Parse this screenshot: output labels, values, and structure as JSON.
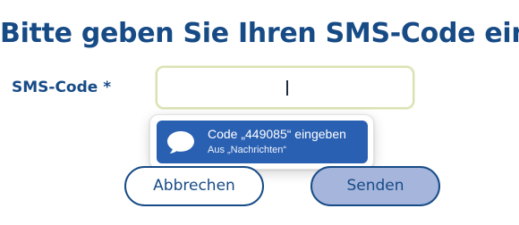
{
  "page": {
    "title": "Bitte geben Sie Ihren SMS-Code ein"
  },
  "form": {
    "sms_code_label": "SMS-Code *",
    "sms_code_value": "",
    "suggestion": {
      "icon": "message-bubble-icon",
      "text": "Code „449085“ eingeben",
      "source": "Aus „Nachrichten“"
    }
  },
  "buttons": {
    "cancel_label": "Abbrechen",
    "send_label": "Senden"
  },
  "colors": {
    "brand_blue": "#174b86",
    "suggestion_bg": "#2a60b2",
    "send_button_bg": "#a5b5dc",
    "input_focus_border": "#d9e2b2"
  }
}
